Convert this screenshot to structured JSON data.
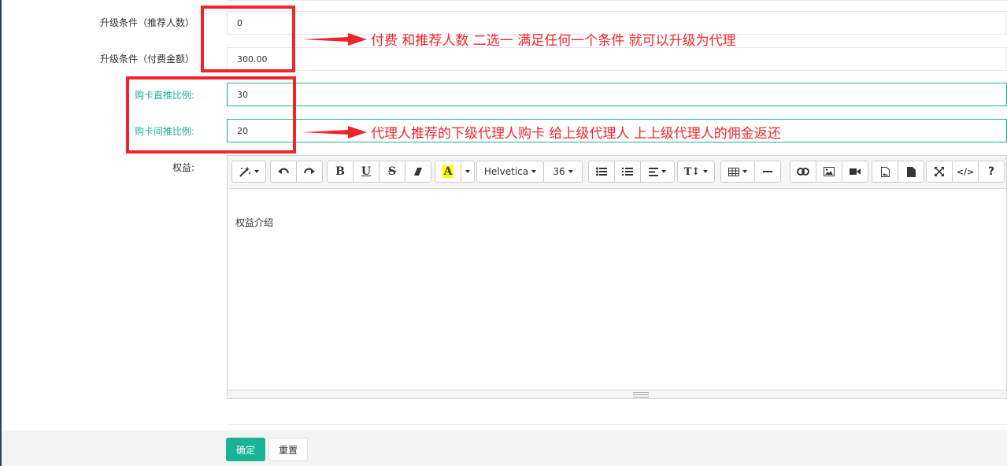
{
  "form": {
    "upgrade_referrals": {
      "label": "升级条件（推荐人数）",
      "value": "0"
    },
    "upgrade_payment": {
      "label": "升级条件（付费金额）",
      "value": "300.00"
    },
    "card_direct_ratio": {
      "label": "购卡直推比例:",
      "value": "30"
    },
    "card_indirect_ratio": {
      "label": "购卡间推比例:",
      "value": "20"
    },
    "benefits_label": "权益:"
  },
  "annotations": {
    "note_upgrade": "付费  和推荐人数  二选一   满足任何一个条件 就可以升级为代理",
    "note_commission": "代理人推荐的下级代理人购卡  给上级代理人  上上级代理人的佣金返还"
  },
  "editor": {
    "content": "权益介绍",
    "font_name": "Helvetica",
    "font_size": "36",
    "icons": [
      "magic-icon",
      "undo-icon",
      "redo-icon",
      "bold-icon",
      "underline-icon",
      "strikethrough-icon",
      "eraser-icon",
      "font-color-icon",
      "unordered-list-icon",
      "ordered-list-icon",
      "align-icon",
      "line-height-icon",
      "table-icon",
      "horizontal-rule-icon",
      "link-icon",
      "image-icon",
      "video-icon",
      "doc-image-icon",
      "file-icon",
      "fullscreen-icon",
      "code-view-icon",
      "help-icon"
    ],
    "glyphs": {
      "bold": "B",
      "underline": "U",
      "strike": "S",
      "color": "A",
      "lineheight": "T↕",
      "code": "</>",
      "help": "?"
    }
  },
  "buttons": {
    "confirm": "确定",
    "reset": "重置"
  },
  "colors": {
    "accent": "#1ab394",
    "annotation": "#f2242b",
    "footer_bg": "#f3f3f4"
  }
}
